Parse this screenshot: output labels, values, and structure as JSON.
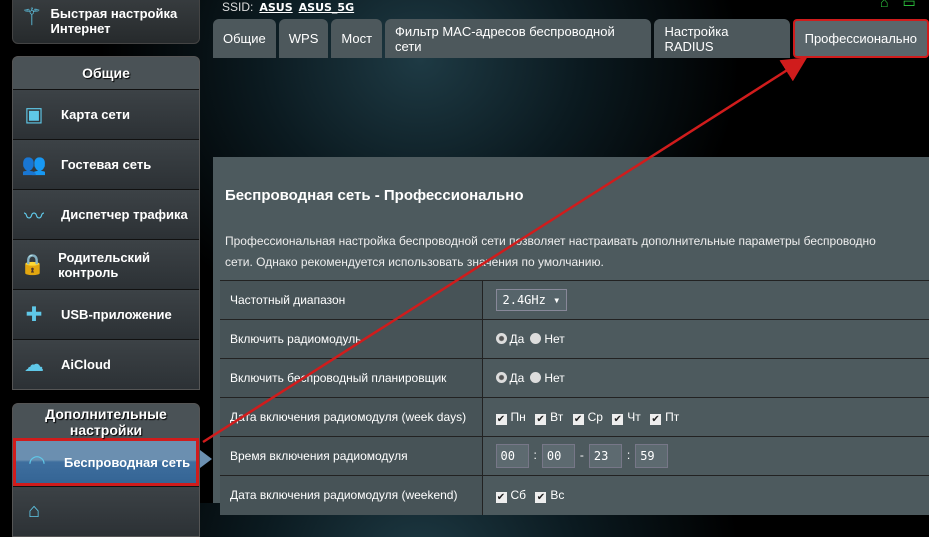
{
  "sidebar": {
    "quick_setup": "Быстрая настройка Интернет",
    "general_header": "Общие",
    "general_items": [
      {
        "label": "Карта сети",
        "icon": "network-map-icon"
      },
      {
        "label": "Гостевая сеть",
        "icon": "guest-network-icon"
      },
      {
        "label": "Диспетчер трафика",
        "icon": "traffic-manager-icon"
      },
      {
        "label": "Родительский контроль",
        "icon": "parental-control-icon"
      },
      {
        "label": "USB-приложение",
        "icon": "usb-app-icon"
      },
      {
        "label": "AiCloud",
        "icon": "aicloud-icon"
      }
    ],
    "advanced_header": "Дополнительные настройки",
    "advanced_items": [
      {
        "label": "Беспроводная сеть",
        "icon": "wifi-icon",
        "active": true
      }
    ]
  },
  "header": {
    "ssid_label": "SSID:",
    "ssid_24": "ASUS",
    "ssid_5": "ASUS_5G"
  },
  "tabs": [
    "Общие",
    "WPS",
    "Мост",
    "Фильтр MAC-адресов беспроводной сети",
    "Настройка RADIUS",
    "Профессионально"
  ],
  "main": {
    "title": "Беспроводная сеть - Профессионально",
    "desc_line1": "Профессиональная настройка беспроводной сети позволяет настраивать дополнительные параметры беспроводно",
    "desc_line2": "сети. Однако рекомендуется использовать значения по умолчанию.",
    "rows": {
      "band_label": "Частотный диапазон",
      "band_value": "2.4GHz ▾",
      "radio_label": "Включить радиомодуль",
      "yes": "Да",
      "no": "Нет",
      "sched_label": "Включить беспроводный планировщик",
      "weekdays_label": "Дата включения радиомодуля (week days)",
      "weekdays": [
        "Пн",
        "Вт",
        "Ср",
        "Чт",
        "Пт"
      ],
      "time_label": "Время включения радиомодуля",
      "time": [
        "00",
        "00",
        "23",
        "59"
      ],
      "weekend_label": "Дата включения радиомодуля (weekend)",
      "weekend": [
        "Сб",
        "Вс"
      ]
    }
  },
  "colors": {
    "highlight": "#d01c1c",
    "accent": "#5fc8e8"
  }
}
